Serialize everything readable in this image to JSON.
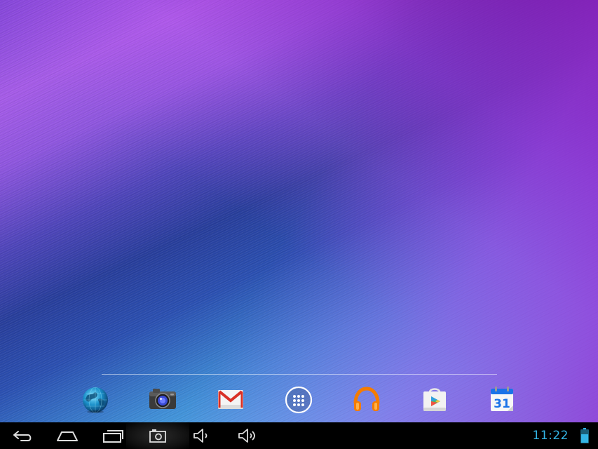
{
  "screen": {
    "type": "android-home-screen"
  },
  "hotseat": {
    "apps": [
      {
        "name": "globe-icon",
        "label": ""
      },
      {
        "name": "camera-icon",
        "label": ""
      },
      {
        "name": "gmail-icon",
        "label": ""
      },
      {
        "name": "all-apps-icon",
        "label": ""
      },
      {
        "name": "headphones-icon",
        "label": ""
      },
      {
        "name": "play-store-icon",
        "label": ""
      },
      {
        "name": "calendar-icon",
        "label": "31"
      }
    ]
  },
  "system_bar": {
    "clock": "11:22",
    "buttons": [
      "back-icon",
      "home-icon",
      "recents-icon",
      "screenshot-icon",
      "volume-down-icon",
      "volume-up-icon"
    ],
    "status": [
      "battery-icon"
    ]
  },
  "colors": {
    "clock": "#33b5e5",
    "battery": "#33b5e5",
    "gmail_red": "#d93025",
    "headphones_orange": "#f57c00",
    "calendar_blue": "#1a73e8"
  }
}
